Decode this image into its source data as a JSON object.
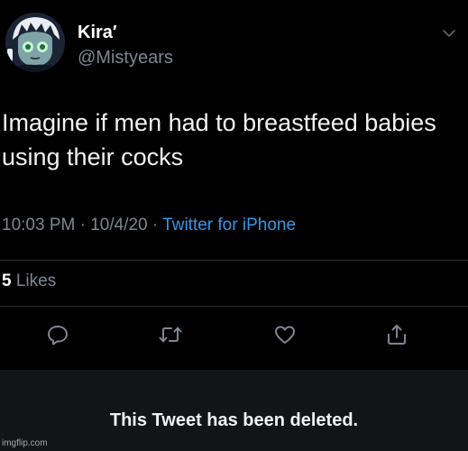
{
  "tweet": {
    "display_name": "Kira′",
    "handle": "@Mistyears",
    "text": "Imagine if men had to breastfeed babies using their cocks",
    "time": "10:03 PM",
    "date": "10/4/20",
    "separator": "·",
    "source": "Twitter for iPhone",
    "likes_count": "5",
    "likes_label": "Likes",
    "actions": [
      "reply-icon",
      "retweet-icon",
      "like-icon",
      "share-icon"
    ]
  },
  "deleted_banner": {
    "text": "This Tweet has been deleted."
  },
  "watermark": "imgflip.com",
  "colors": {
    "background": "#000000",
    "link_blue": "#3896e6",
    "muted_text": "#7d8792",
    "banner_bg": "#121416"
  }
}
